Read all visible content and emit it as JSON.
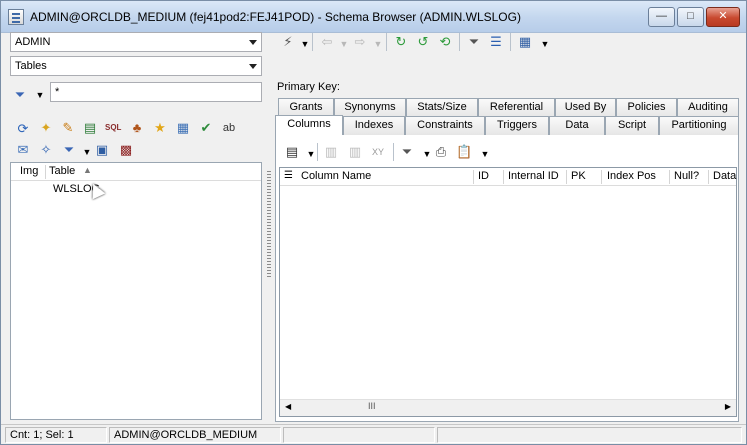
{
  "window": {
    "title": "ADMIN@ORCLDB_MEDIUM (fej41pod2:FEJ41POD) - Schema Browser (ADMIN.WLSLOG)",
    "minimize_glyph": "—",
    "maximize_glyph": "□",
    "close_glyph": "✕"
  },
  "left": {
    "schema_value": "ADMIN",
    "object_type_value": "Tables",
    "filter_value": "*",
    "list": {
      "headers": [
        "Img",
        "Table"
      ],
      "rows": [
        {
          "table": "WLSLOG"
        }
      ]
    }
  },
  "right": {
    "primary_key_label": "Primary Key:",
    "tabs_row1": [
      "Grants",
      "Synonyms",
      "Stats/Size",
      "Referential",
      "Used By",
      "Policies",
      "Auditing"
    ],
    "tabs_row2": [
      "Columns",
      "Indexes",
      "Constraints",
      "Triggers",
      "Data",
      "Script",
      "Partitioning"
    ],
    "active_tab": "Columns",
    "grid_headers": [
      "Column Name",
      "ID",
      "Internal ID",
      "PK",
      "Index Pos",
      "Null?",
      "Data"
    ],
    "scroll_thumb": "III"
  },
  "status": {
    "counts": "Cnt: 1; Sel: 1",
    "connection": "ADMIN@ORCLDB_MEDIUM"
  },
  "icons": {
    "left_row1": [
      "refresh-icon",
      "flashlight-icon",
      "pencil-icon",
      "copy-table-icon",
      "sql-icon",
      "tree-icon",
      "star-icon",
      "grid-icon",
      "check-icon",
      "ab-icon"
    ],
    "left_row2": [
      "notepad-icon",
      "wand-icon",
      "filter-icon",
      "monitor-icon",
      "save-icon"
    ],
    "toolbar_right": [
      "connect-icon",
      "back-icon",
      "forward-icon",
      "refresh-green-icon",
      "refresh-green2-icon",
      "refresh-green3-icon",
      "filter-icon",
      "list-icon",
      "calendar-icon"
    ]
  }
}
